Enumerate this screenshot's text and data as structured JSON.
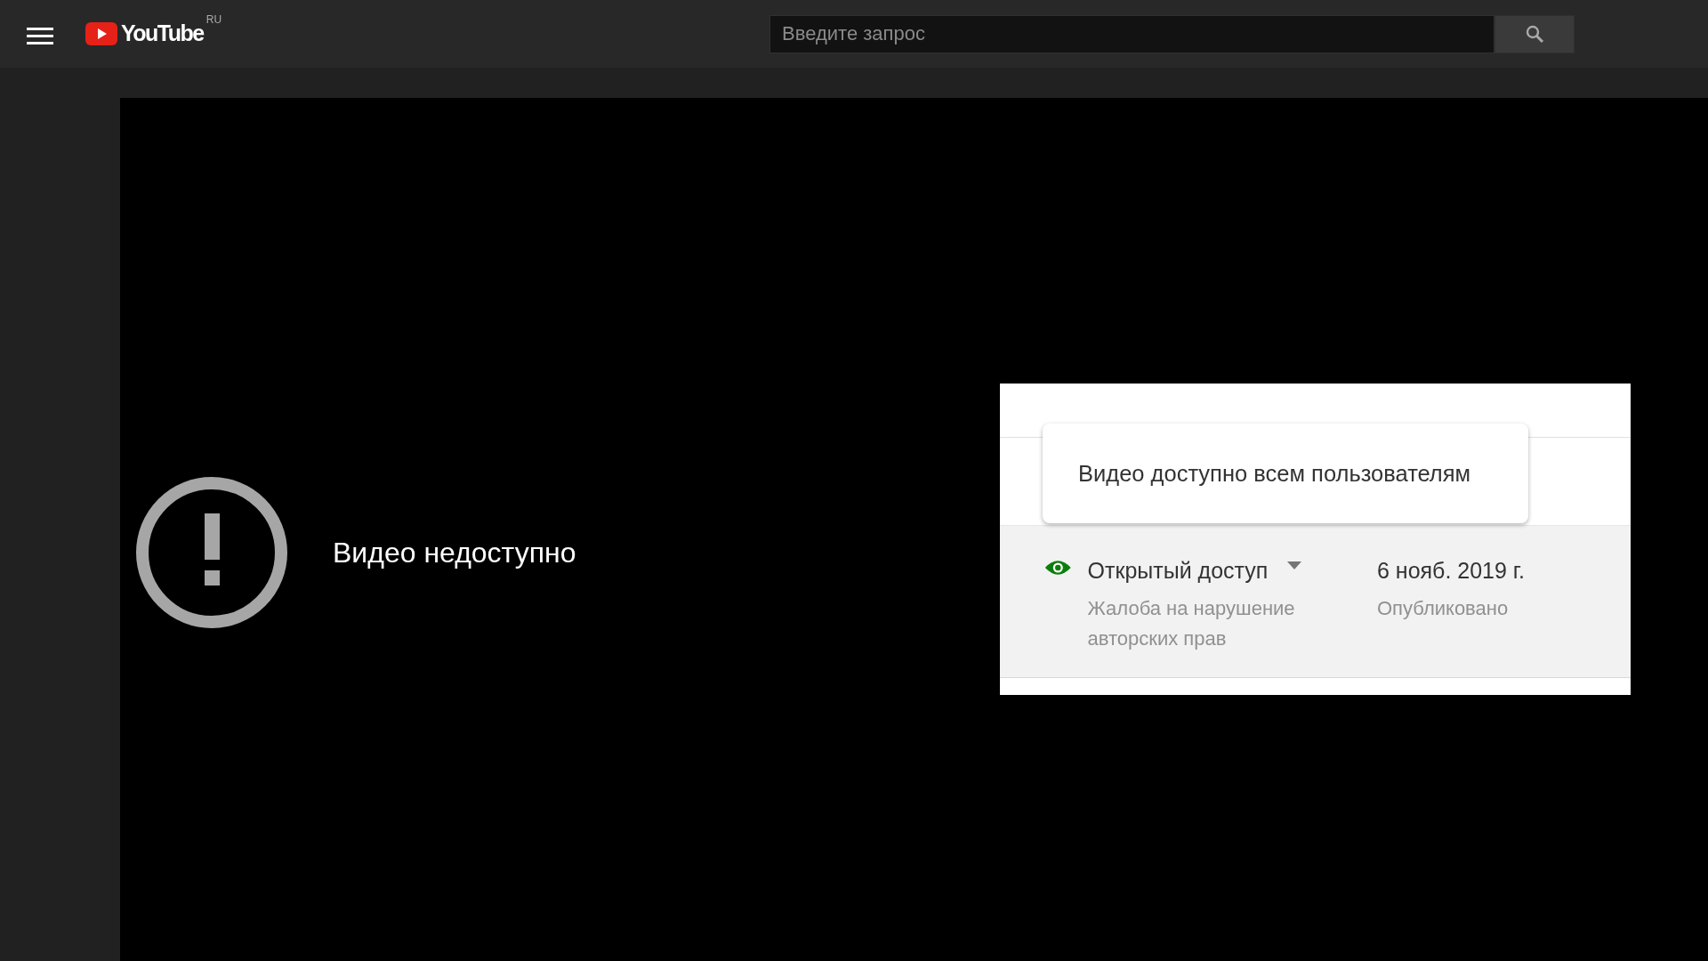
{
  "header": {
    "logo": {
      "wordmark": "YouTube",
      "region": "RU"
    },
    "search": {
      "placeholder": "Введите запрос"
    }
  },
  "player": {
    "error_message": "Видео недоступно"
  },
  "inset": {
    "tooltip": "Видео доступно всем пользователям",
    "visibility": {
      "label": "Открытый доступ",
      "note": "Жалоба на нарушение авторских прав"
    },
    "date": {
      "value": "6 нояб. 2019 г.",
      "label": "Опубликовано"
    }
  }
}
